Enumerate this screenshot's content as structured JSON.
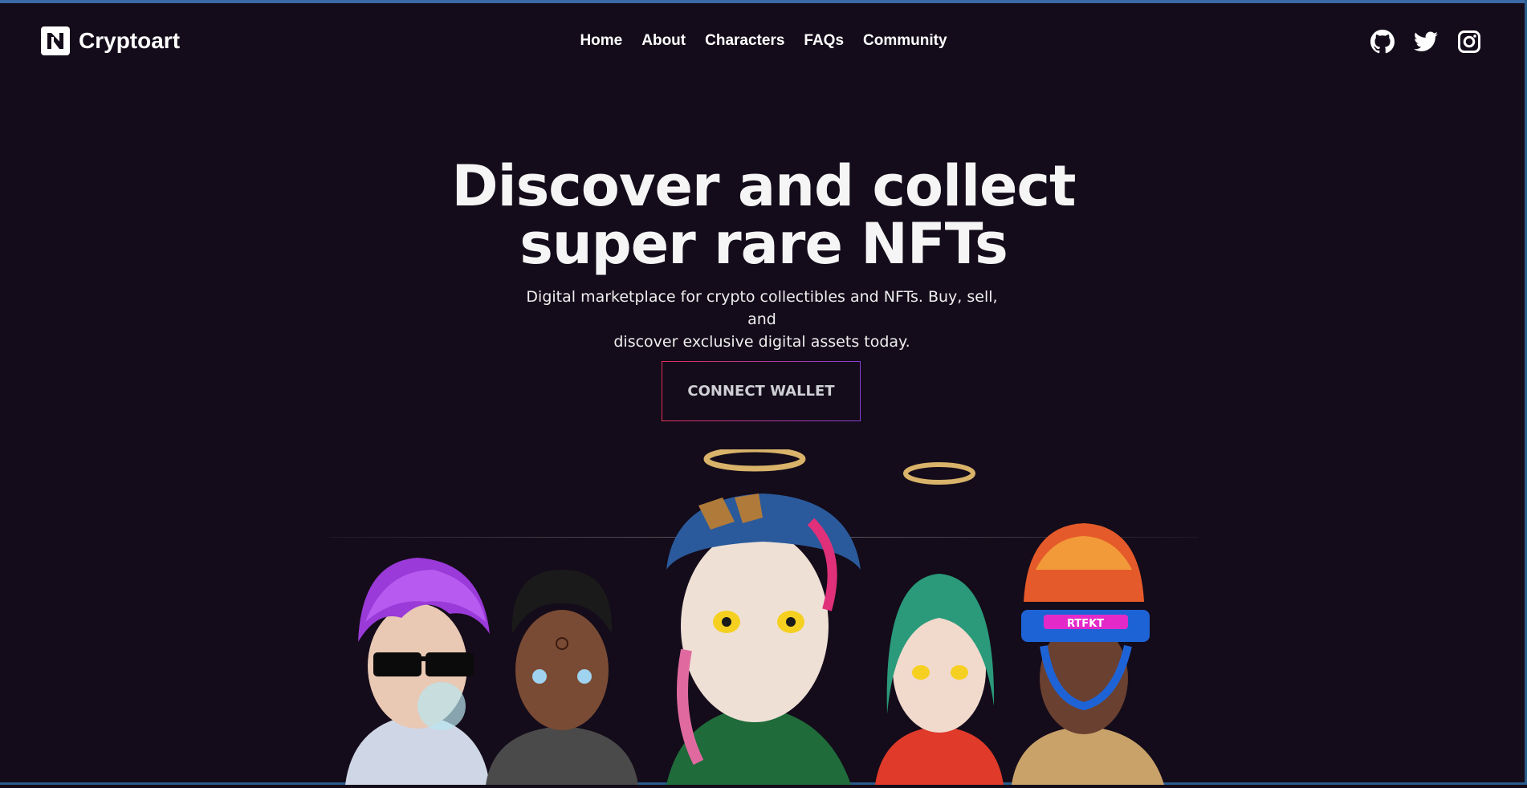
{
  "brand": {
    "name": "Cryptoart",
    "logo_icon": "n-logo-icon"
  },
  "nav": {
    "items": [
      {
        "label": "Home"
      },
      {
        "label": "About"
      },
      {
        "label": "Characters"
      },
      {
        "label": "FAQs"
      },
      {
        "label": "Community"
      }
    ]
  },
  "socials": [
    {
      "icon": "github-icon"
    },
    {
      "icon": "twitter-icon"
    },
    {
      "icon": "instagram-icon"
    }
  ],
  "hero": {
    "title_line1": "Discover and collect",
    "title_line2": "super rare NFTs",
    "subtitle_line1": "Digital marketplace for crypto collectibles and NFTs. Buy, sell, and",
    "subtitle_line2": "discover exclusive digital assets today.",
    "cta_label": "CONNECT WALLET"
  },
  "characters": {
    "visor_text": "RTFKT"
  },
  "colors": {
    "background": "#140c1a",
    "text": "#f5f5f5",
    "cta_border_start": "#e0315a",
    "cta_border_end": "#8a3fd6"
  }
}
